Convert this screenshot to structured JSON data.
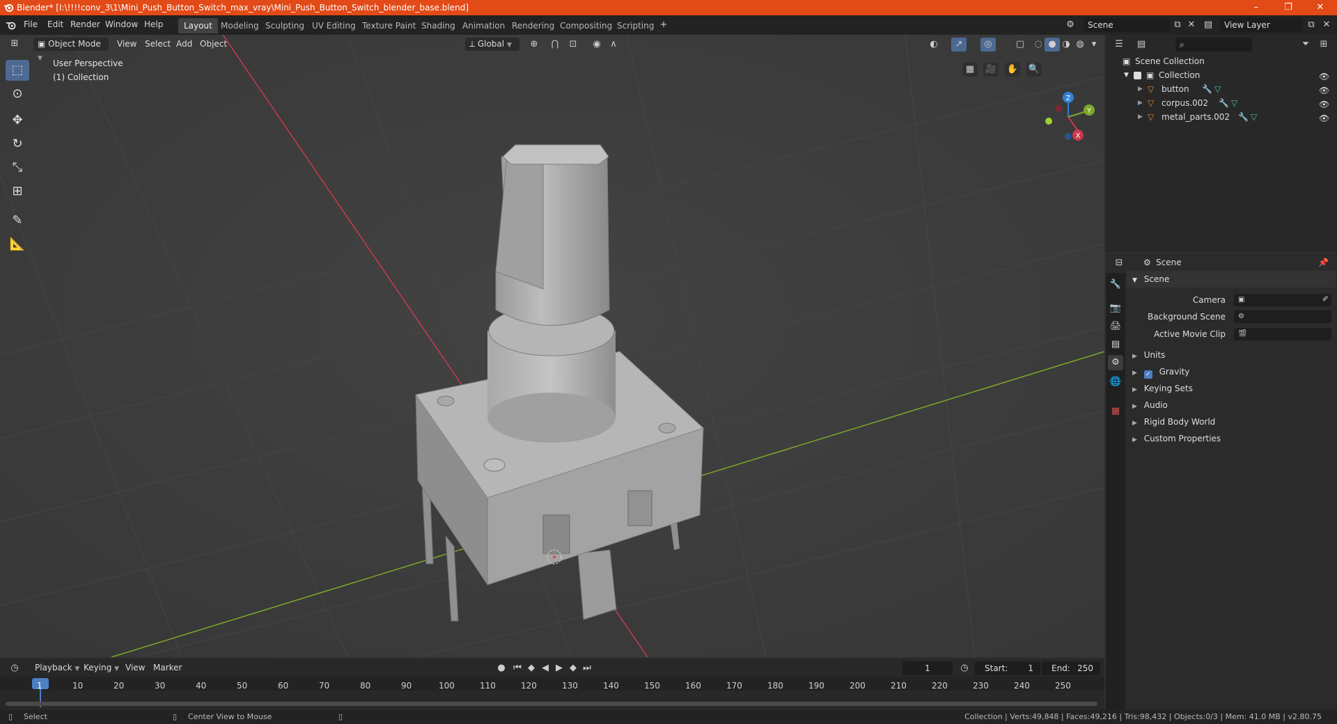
{
  "window": {
    "title": "Blender* [I:\\!!!!conv_3\\1\\Mini_Push_Button_Switch_max_vray\\Mini_Push_Button_Switch_blender_base.blend]",
    "minimize": "–",
    "maximize": "❐",
    "close": "✕"
  },
  "menu": [
    "File",
    "Edit",
    "Render",
    "Window",
    "Help"
  ],
  "workspaces": [
    "Layout",
    "Modeling",
    "Sculpting",
    "UV Editing",
    "Texture Paint",
    "Shading",
    "Animation",
    "Rendering",
    "Compositing",
    "Scripting"
  ],
  "active_workspace": "Layout",
  "scene_field": "Scene",
  "view_layer_field": "View Layer",
  "viewport": {
    "mode": "Object Mode",
    "menus": [
      "View",
      "Select",
      "Add",
      "Object"
    ],
    "transform_orientation": "Global",
    "overlay_text": {
      "perspective": "User Perspective",
      "collection": "(1) Collection"
    },
    "gizmo_axes": {
      "x": "X",
      "y": "Y",
      "z": "Z"
    },
    "colors": {
      "x_axis": "#c9394d",
      "y_axis": "#7ca82b",
      "z_axis": "#2f7fd8",
      "background": "#3d3d3d"
    }
  },
  "outliner": {
    "root": "Scene Collection",
    "collection": "Collection",
    "objects": [
      "button",
      "corpus.002",
      "metal_parts.002"
    ]
  },
  "properties": {
    "context": "Scene",
    "panel_title": "Scene",
    "fields": [
      {
        "label": "Camera",
        "value": ""
      },
      {
        "label": "Background Scene",
        "value": ""
      },
      {
        "label": "Active Movie Clip",
        "value": ""
      }
    ],
    "sections": [
      "Units",
      "Gravity",
      "Keying Sets",
      "Audio",
      "Rigid Body World",
      "Custom Properties"
    ],
    "gravity_checked": true
  },
  "timeline": {
    "menus": [
      "Playback",
      "Keying",
      "View",
      "Marker"
    ],
    "current_frame": "1",
    "start_label": "Start:",
    "start": "1",
    "end_label": "End:",
    "end": "250",
    "ruler": [
      "1",
      "10",
      "20",
      "30",
      "40",
      "50",
      "60",
      "70",
      "80",
      "90",
      "100",
      "110",
      "120",
      "130",
      "140",
      "150",
      "160",
      "170",
      "180",
      "190",
      "200",
      "210",
      "220",
      "230",
      "240",
      "250"
    ]
  },
  "status": {
    "left_action": "Select",
    "middle_action": "Center View to Mouse",
    "stats": "Collection | Verts:49,848 | Faces:49,216 | Tris:98,432 | Objects:0/3 | Mem: 41.0 MB | v2.80.75"
  }
}
